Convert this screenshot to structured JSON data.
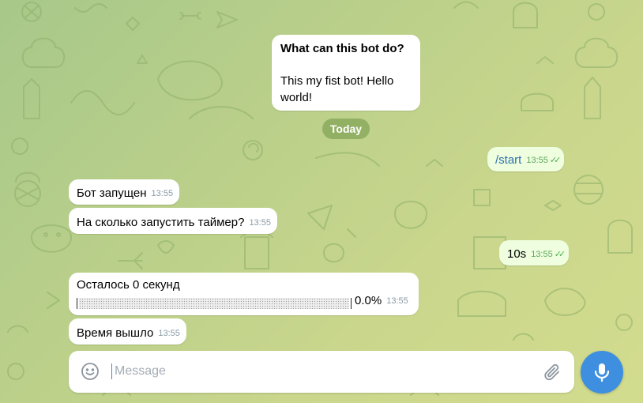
{
  "theme": {
    "accent": "#3e8fe0",
    "outgoing_bubble": "#eefedf",
    "incoming_bubble": "#ffffff",
    "check_color": "#4fae4e"
  },
  "intro": {
    "title": "What can this bot do?",
    "body": "This my fist bot! Hello world!"
  },
  "date_separator": "Today",
  "messages": [
    {
      "text": "/start",
      "time": "13:55",
      "direction": "out",
      "read": true
    },
    {
      "text": "Бот запущен",
      "time": "13:55",
      "direction": "in"
    },
    {
      "text": "На сколько запустить таймер?",
      "time": "13:55",
      "direction": "in"
    },
    {
      "text": "10s",
      "time": "13:55",
      "direction": "out",
      "read": true
    },
    {
      "text": "Осталось 0 секунд",
      "time": "13:55",
      "direction": "in",
      "progress_label": "0.0%",
      "progress": 0.0
    },
    {
      "text": "Время вышло",
      "time": "13:55",
      "direction": "in"
    }
  ],
  "composer": {
    "placeholder": "Message",
    "emoji_icon": "smile-icon",
    "attach_icon": "paperclip-icon",
    "mic_icon": "microphone-icon"
  }
}
